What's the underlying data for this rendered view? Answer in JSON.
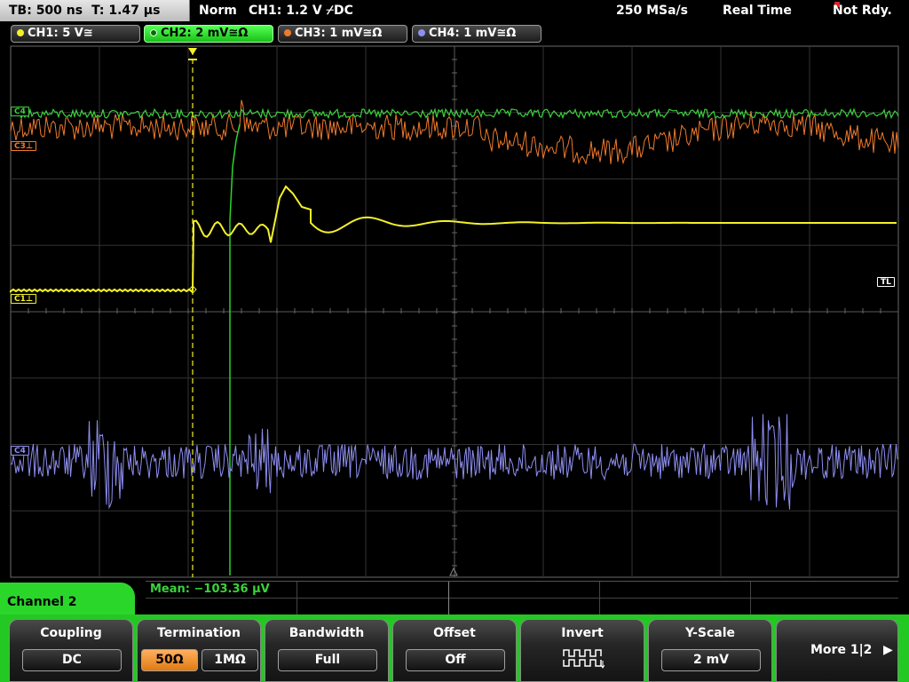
{
  "status_bar": {
    "timebase": "TB: 500 ns",
    "trigger_pos": "T: 1.47 µs",
    "trigger_mode": "Norm",
    "trigger_info": "CH1: 1.2 V ⌿DC",
    "sample_rate": "250 MSa/s",
    "acquisition_mode": "Real Time",
    "status": "Not Rdy."
  },
  "channels": [
    {
      "label": "CH1: 5 V≅",
      "color": "#f4f02a",
      "active": false
    },
    {
      "label": "CH2: 2 mV≅Ω",
      "color": "#18c018",
      "active": true
    },
    {
      "label": "CH3: 1 mV≅Ω",
      "color": "#f07a2c",
      "active": false
    },
    {
      "label": "CH4: 1 mV≅Ω",
      "color": "#8e8ef2",
      "active": false
    }
  ],
  "markers": {
    "c4": "C4",
    "c3": "C3⊥",
    "c1": "C1⊥",
    "c4b": "C4",
    "tl": "TL"
  },
  "measurement": {
    "mean": "Mean: −103.36 µV"
  },
  "menu": {
    "title": "Channel 2",
    "coupling": {
      "title": "Coupling",
      "value": "DC"
    },
    "termination": {
      "title": "Termination",
      "option_a": "50Ω",
      "option_b": "1MΩ",
      "selected": "50Ω"
    },
    "bandwidth": {
      "title": "Bandwidth",
      "value": "Full"
    },
    "offset": {
      "title": "Offset",
      "value": "Off"
    },
    "invert": {
      "title": "Invert",
      "icon": "invert-waveform-icon"
    },
    "yscale": {
      "title": "Y-Scale",
      "value": "2 mV"
    },
    "more": {
      "label": "More 1|2",
      "icon": "arrow-right-icon"
    }
  },
  "colors": {
    "ch1": "#f4f02a",
    "ch2": "#3bd23b",
    "ch3": "#f07a2c",
    "ch4": "#8e8ef2",
    "menu_accent": "#23c823"
  }
}
